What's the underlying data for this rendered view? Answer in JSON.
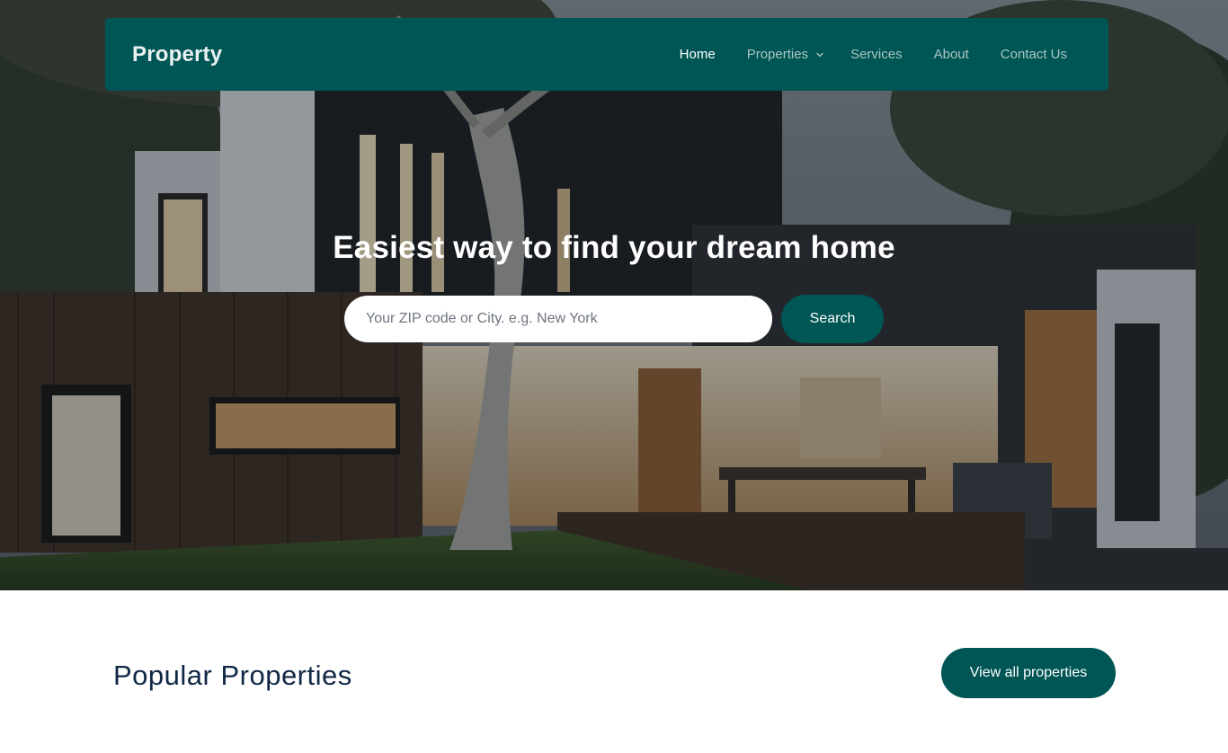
{
  "navbar": {
    "brand": "Property",
    "links": [
      {
        "label": "Home",
        "active": true
      },
      {
        "label": "Properties",
        "has_dropdown": true
      },
      {
        "label": "Services"
      },
      {
        "label": "About"
      },
      {
        "label": "Contact Us"
      }
    ]
  },
  "hero": {
    "title": "Easiest way to find your dream home",
    "search_placeholder": "Your ZIP code or City. e.g. New York",
    "search_button": "Search"
  },
  "popular": {
    "title": "Popular Properties",
    "view_all_button": "View all properties"
  },
  "colors": {
    "primary": "#005555",
    "heading": "#102745",
    "nav_inactive": "#a9c7c3"
  },
  "icons": {
    "dropdown": "chevron-down-icon"
  }
}
